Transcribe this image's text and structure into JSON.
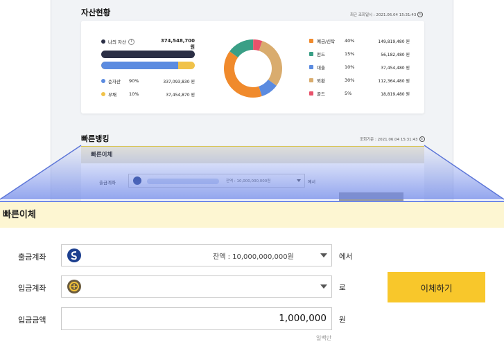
{
  "asset": {
    "title": "자산현황",
    "timestamp": "최근 조회일시 : 2021.06.04 15:31:43",
    "total_label": "나의 자산",
    "help": "?",
    "total_value": "374,548,700 원",
    "rows": [
      {
        "label": "순자산",
        "pct": "90%",
        "amount": "337,093,830 원",
        "color": "#5b8be0"
      },
      {
        "label": "부채",
        "pct": "10%",
        "amount": "37,454,870 원",
        "color": "#f0c24a"
      }
    ],
    "donut_fractions": [
      0.4,
      0.15,
      0.1,
      0.3,
      0.05
    ],
    "legend": [
      {
        "label": "예금/신탁",
        "pct": "40%",
        "amount": "149,819,480 원",
        "color": "#f08a2c"
      },
      {
        "label": "펀드",
        "pct": "15%",
        "amount": "56,182,480 원",
        "color": "#3a9f86"
      },
      {
        "label": "대출",
        "pct": "10%",
        "amount": "37,454,480 원",
        "color": "#5b8be0"
      },
      {
        "label": "외환",
        "pct": "30%",
        "amount": "112,364,480 원",
        "color": "#d9ac6e"
      },
      {
        "label": "골드",
        "pct": "5%",
        "amount": "18,819,480 원",
        "color": "#e8526b"
      }
    ]
  },
  "quick": {
    "title": "빠른뱅킹",
    "timestamp": "조회기준 : 2021.06.04 15:31:43",
    "panel_title": "빠른이체",
    "mini_from_label": "출금계좌",
    "mini_balance": "잔액 : 10,000,000,000원",
    "mini_suffix": "에서"
  },
  "zoom": {
    "title": "빠른이체",
    "from_label": "출금계좌",
    "from_balance": "잔액 : 10,000,000,000원",
    "from_suffix": "에서",
    "to_label": "입금계좌",
    "to_suffix": "로",
    "amount_label": "입금금액",
    "amount_value": "1,000,000",
    "amount_suffix": "원",
    "amount_hint": "일백만",
    "submit_label": "이체하기"
  }
}
